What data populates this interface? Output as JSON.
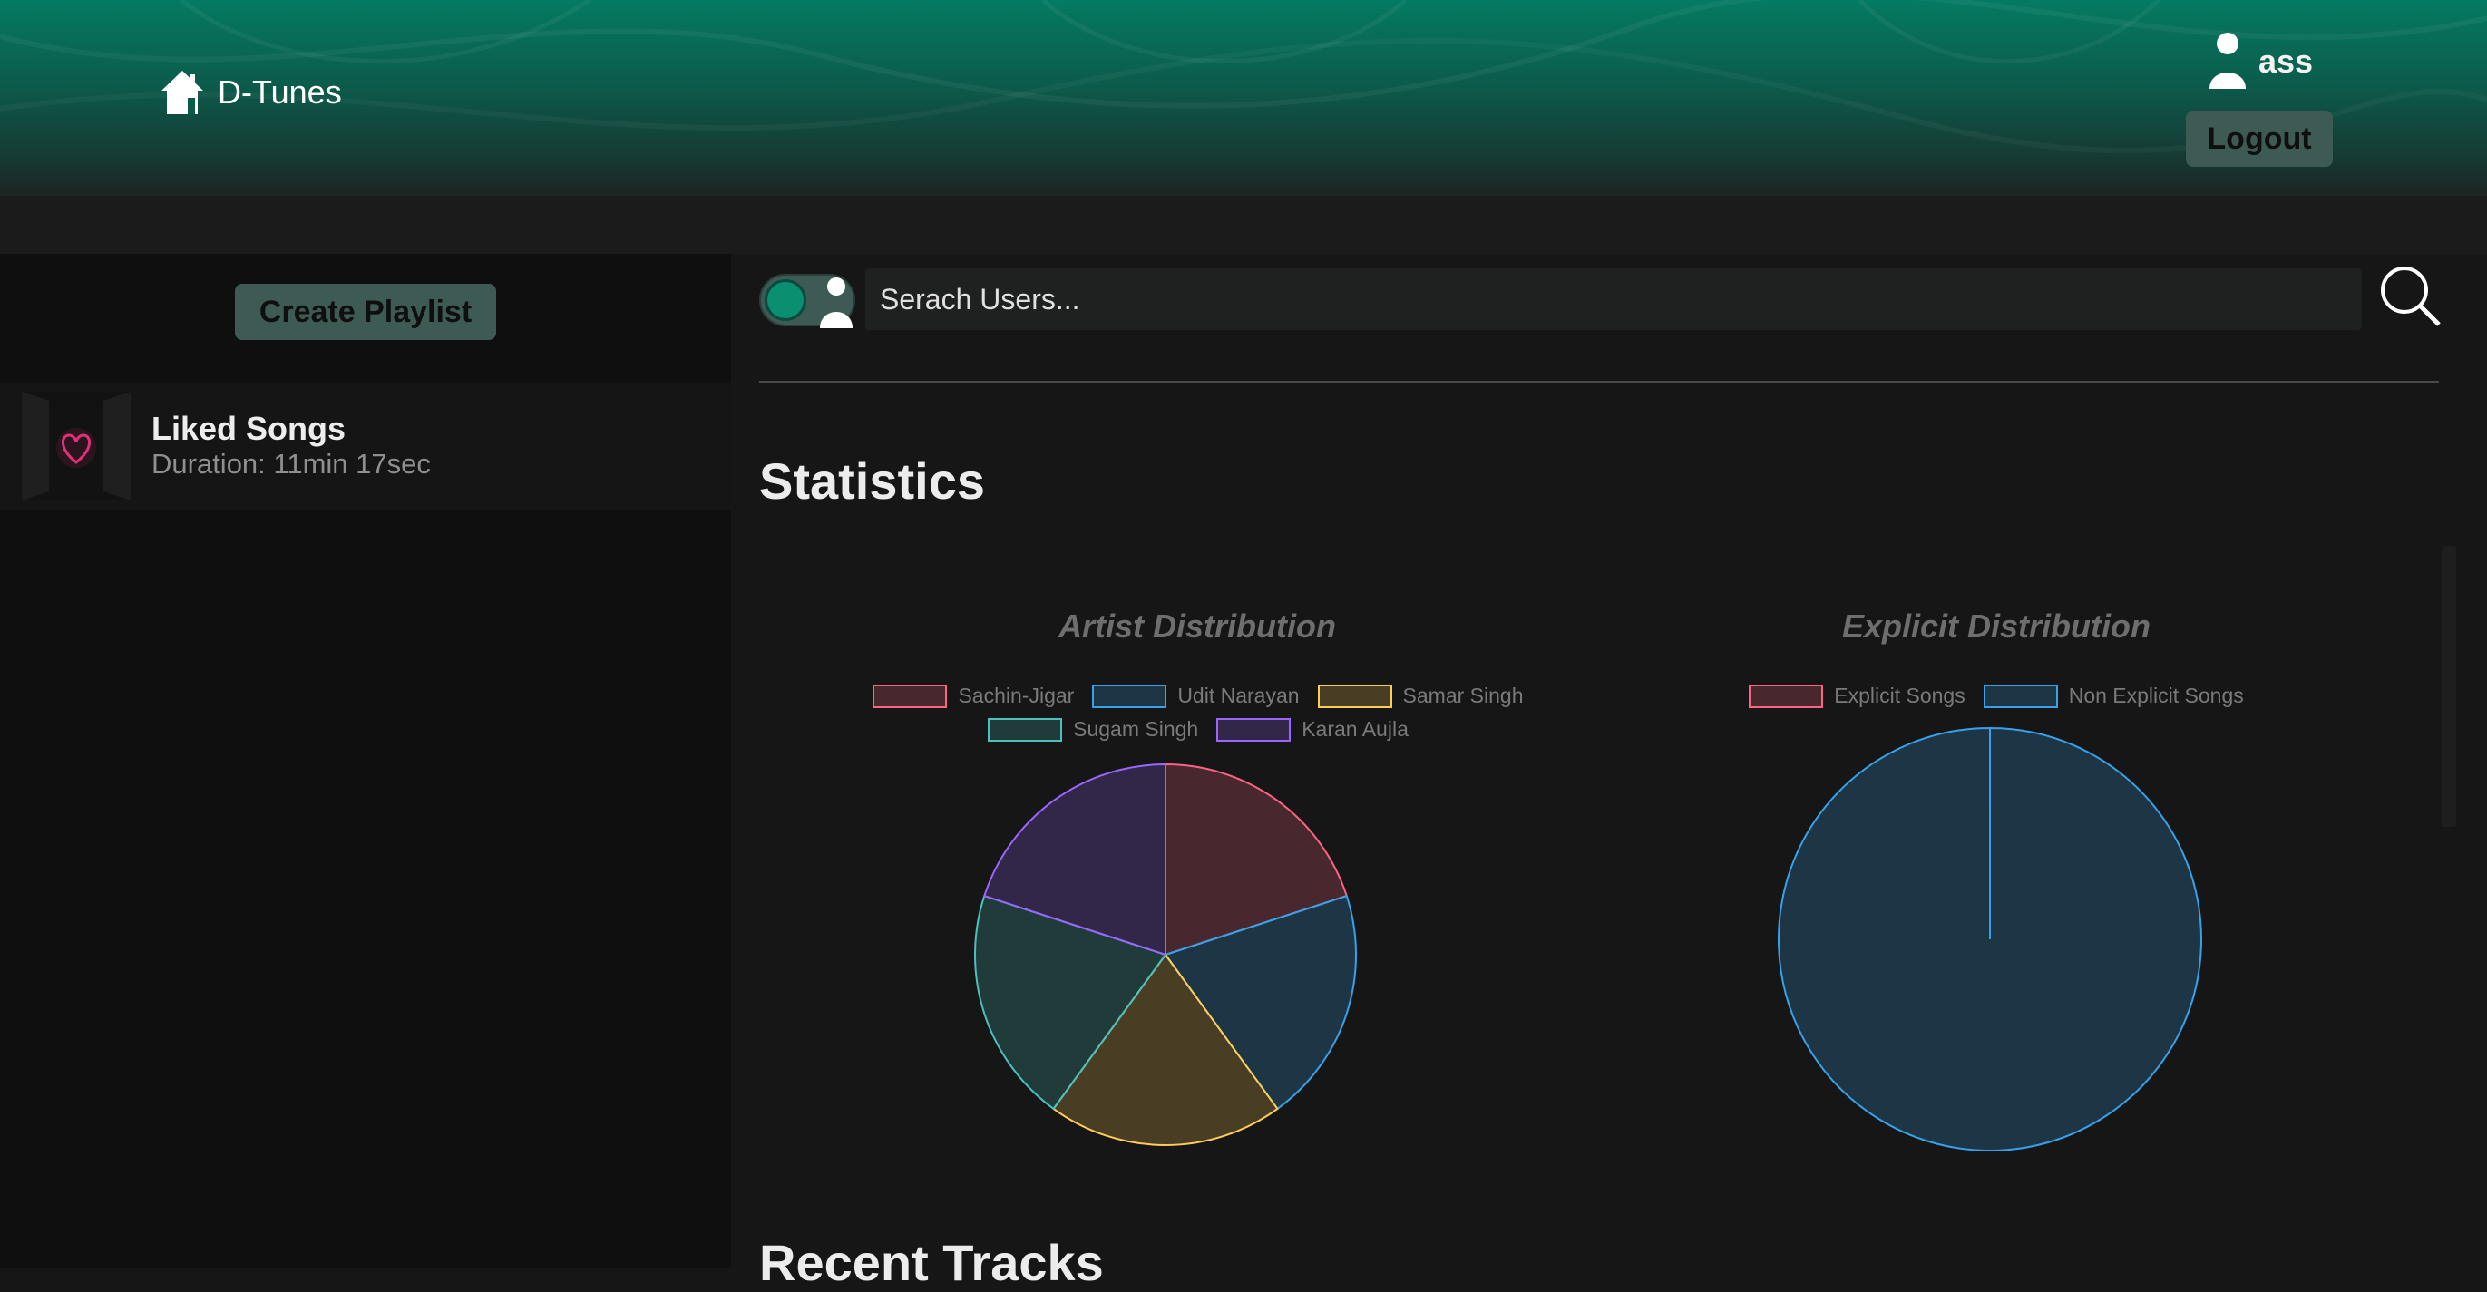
{
  "header": {
    "brand_name": "D-Tunes",
    "user_name": "ass",
    "logout_label": "Logout"
  },
  "sidebar": {
    "create_playlist_label": "Create Playlist",
    "playlists": [
      {
        "title": "Liked Songs",
        "duration": "Duration: 11min 17sec"
      }
    ]
  },
  "search": {
    "placeholder": "Serach Users...",
    "mode": "users"
  },
  "statistics": {
    "title": "Statistics",
    "recent_tracks_title": "Recent Tracks"
  },
  "chart_data": [
    {
      "type": "pie",
      "title": "Artist Distribution",
      "legend_position": "top",
      "labels": [
        "Sachin-Jigar",
        "Udit Narayan",
        "Samar Singh",
        "Sugam Singh",
        "Karan Aujla"
      ],
      "values": [
        1,
        1,
        1,
        1,
        1
      ],
      "colors": [
        "#ff6384",
        "#36a2eb",
        "#ffcd56",
        "#4bc0c0",
        "#9966ff"
      ]
    },
    {
      "type": "pie",
      "title": "Explicit Distribution",
      "legend_position": "top",
      "labels": [
        "Explicit Songs",
        "Non Explicit Songs"
      ],
      "values": [
        0,
        1
      ],
      "colors": [
        "#ff6384",
        "#36a2eb"
      ]
    }
  ]
}
